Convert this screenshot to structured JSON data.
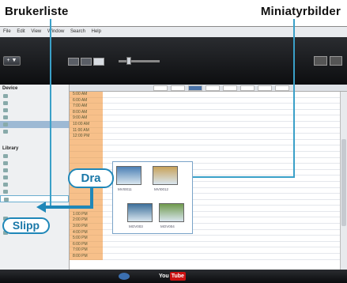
{
  "callouts": {
    "left_title": "Brukerliste",
    "right_title": "Miniatyrbilder",
    "drag_label": "Dra",
    "drop_label": "Slipp"
  },
  "app": {
    "menu_items": [
      "File",
      "Edit",
      "View",
      "Window",
      "Search",
      "Help"
    ],
    "toolbar": {
      "add_label": "+ ▼"
    },
    "sidebar": {
      "devices_header": "Device",
      "library_header": "Library"
    },
    "timeline": {
      "times": [
        "5:00 AM",
        "6:00 AM",
        "7:00 AM",
        "8:00 AM",
        "9:00 AM",
        "10:00 AM",
        "11:00 AM",
        "12:00 PM",
        "",
        "",
        "",
        "",
        "",
        "",
        "",
        "",
        "",
        "",
        "",
        "",
        "1:00 PM",
        "2:00 PM",
        "3:00 PM",
        "4:00 PM",
        "5:00 PM",
        "6:00 PM",
        "7:00 PM",
        "8:00 PM"
      ],
      "accent_color": "#f7c08a"
    },
    "thumbnails": {
      "items": [
        {
          "caption": "MVI0011",
          "color": "#4b7fb5"
        },
        {
          "caption": "MVI0012",
          "color": "#c8a25a"
        },
        {
          "caption": "MOV003",
          "color": "#3d6f9a"
        },
        {
          "caption": "MOV004",
          "color": "#6f9a4d"
        }
      ]
    },
    "bottom_bar": {
      "brand_you": "You",
      "brand_tube": "Tube"
    }
  }
}
